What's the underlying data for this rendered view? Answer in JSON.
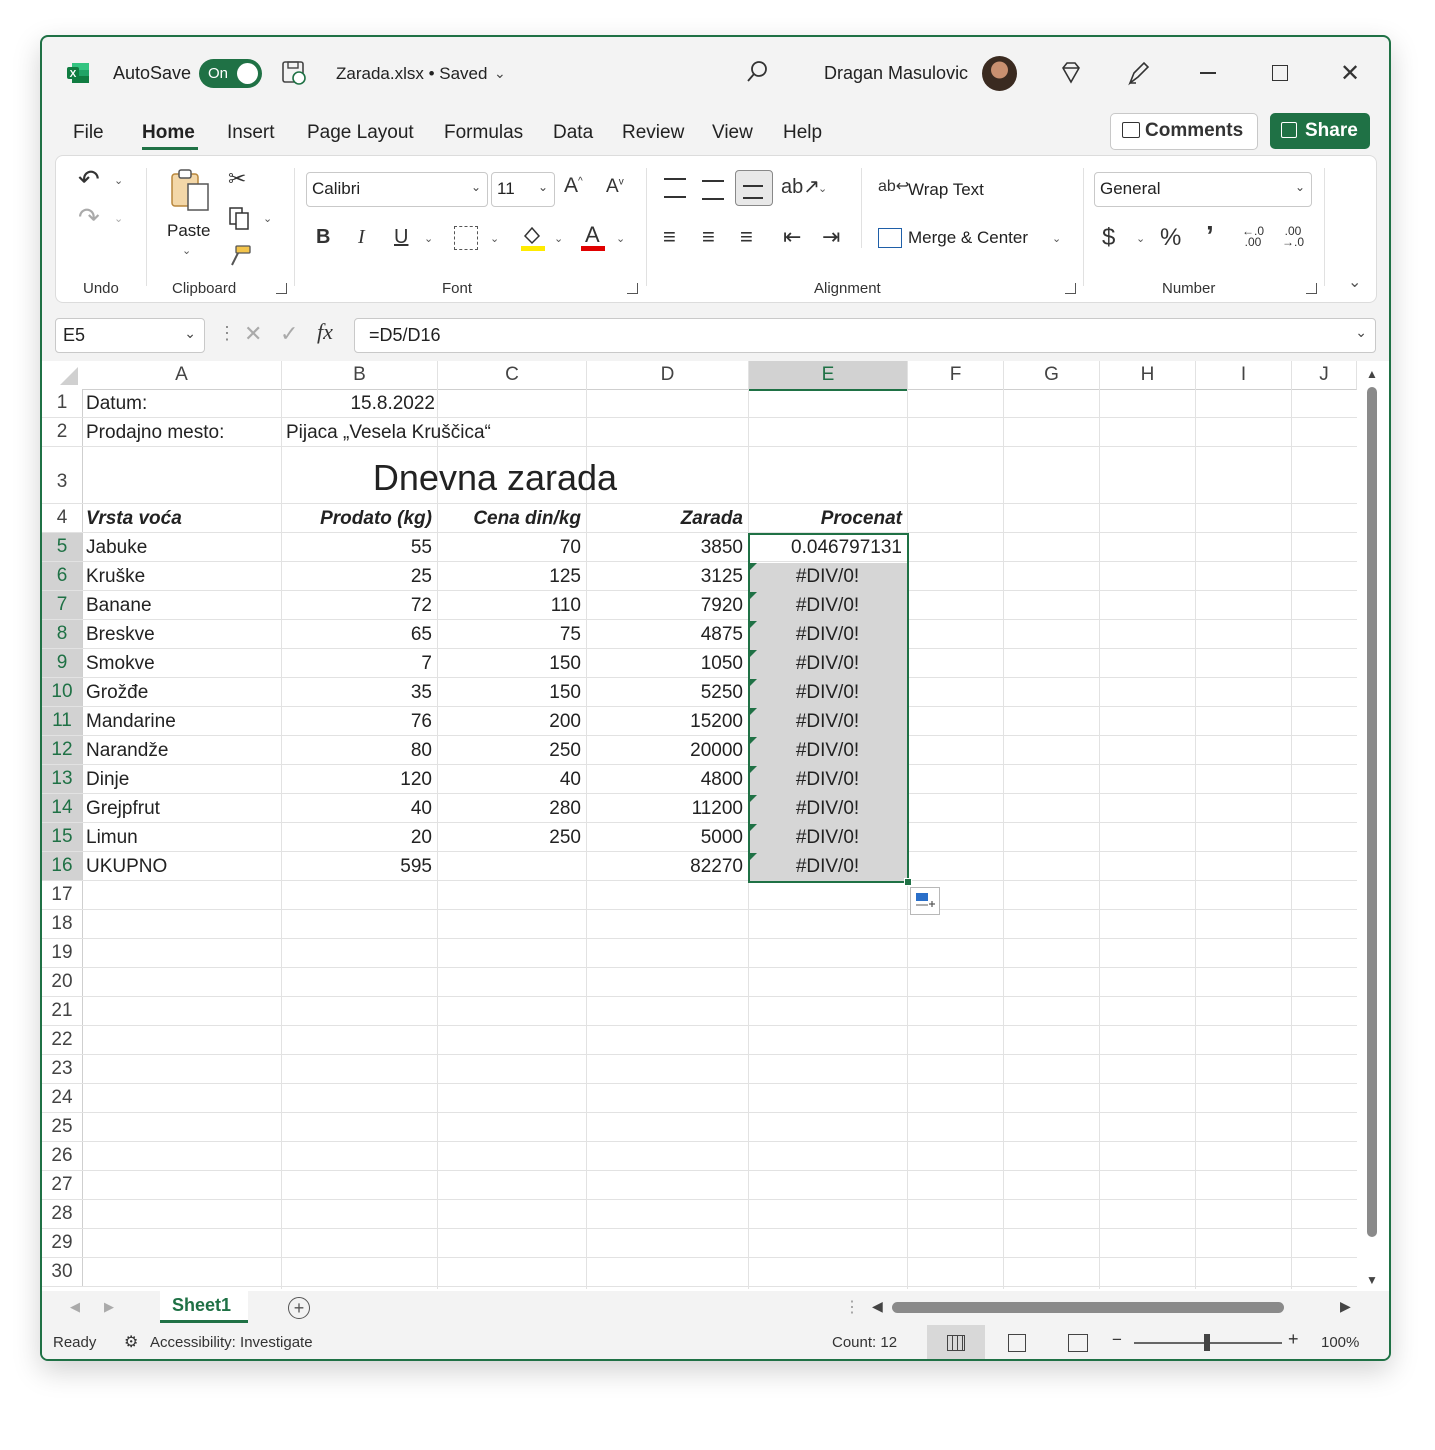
{
  "titlebar": {
    "app_icon": "excel-icon",
    "autosave_label": "AutoSave",
    "autosave_state": "On",
    "filename": "Zarada.xlsx • Saved",
    "user_name": "Dragan Masulovic"
  },
  "tabs": [
    "File",
    "Home",
    "Insert",
    "Page Layout",
    "Formulas",
    "Data",
    "Review",
    "View",
    "Help"
  ],
  "active_tab": "Home",
  "comments_label": "Comments",
  "share_label": "Share",
  "ribbon": {
    "undo_group": "Undo",
    "paste_label": "Paste",
    "clipboard_group": "Clipboard",
    "font_name": "Calibri",
    "font_size": "11",
    "font_group": "Font",
    "wrap_text": "Wrap Text",
    "merge_center": "Merge & Center",
    "alignment_group": "Alignment",
    "number_format": "General",
    "number_group": "Number",
    "bold": "B",
    "italic": "I",
    "underline": "U"
  },
  "formula_bar": {
    "name_box": "E5",
    "fx": "fx",
    "formula": "=D5/D16"
  },
  "columns": [
    "A",
    "B",
    "C",
    "D",
    "E",
    "F",
    "G",
    "H",
    "I",
    "J"
  ],
  "selected_column": "E",
  "rows": [
    "1",
    "2",
    "3",
    "4",
    "5",
    "6",
    "7",
    "8",
    "9",
    "10",
    "11",
    "12",
    "13",
    "14",
    "15",
    "16",
    "17",
    "18",
    "19",
    "20",
    "21",
    "22",
    "23",
    "24",
    "25",
    "26",
    "27",
    "28",
    "29",
    "30"
  ],
  "sheet": {
    "datum_label": "Datum:",
    "datum_value": "15.8.2022",
    "mesto_label": "Prodajno mesto:",
    "mesto_value": "Pijaca „Vesela Kruščica“",
    "title": "Dnevna zarada",
    "headers": [
      "Vrsta voća",
      "Prodato (kg)",
      "Cena din/kg",
      "Zarada",
      "Procenat"
    ],
    "data": [
      [
        "Jabuke",
        "55",
        "70",
        "3850",
        "0.046797131"
      ],
      [
        "Kruške",
        "25",
        "125",
        "3125",
        "#DIV/0!"
      ],
      [
        "Banane",
        "72",
        "110",
        "7920",
        "#DIV/0!"
      ],
      [
        "Breskve",
        "65",
        "75",
        "4875",
        "#DIV/0!"
      ],
      [
        "Smokve",
        "7",
        "150",
        "1050",
        "#DIV/0!"
      ],
      [
        "Grožđe",
        "35",
        "150",
        "5250",
        "#DIV/0!"
      ],
      [
        "Mandarine",
        "76",
        "200",
        "15200",
        "#DIV/0!"
      ],
      [
        "Narandže",
        "80",
        "250",
        "20000",
        "#DIV/0!"
      ],
      [
        "Dinje",
        "120",
        "40",
        "4800",
        "#DIV/0!"
      ],
      [
        "Grejpfrut",
        "40",
        "280",
        "11200",
        "#DIV/0!"
      ],
      [
        "Limun",
        "20",
        "250",
        "5000",
        "#DIV/0!"
      ],
      [
        "UKUPNO",
        "595",
        "",
        "82270",
        "#DIV/0!"
      ]
    ]
  },
  "sheet_tab": "Sheet1",
  "status": {
    "ready": "Ready",
    "accessibility": "Accessibility: Investigate",
    "count": "Count: 12",
    "zoom": "100%"
  },
  "colors": {
    "accent": "#1f7145",
    "selection_fill": "#d6d6d6"
  }
}
